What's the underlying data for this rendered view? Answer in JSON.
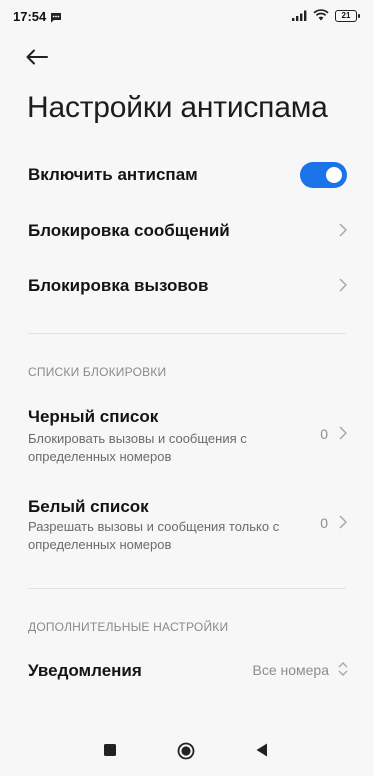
{
  "status_bar": {
    "time": "17:54",
    "battery": "21",
    "icons": [
      "message-icon",
      "signal-icon",
      "wifi-icon",
      "battery-icon"
    ]
  },
  "header": {
    "back_icon": "arrow-left-icon",
    "title": "Настройки антиспама"
  },
  "settings": {
    "enable_antispam": {
      "label": "Включить антиспам",
      "enabled": true
    },
    "block_messages": {
      "label": "Блокировка сообщений"
    },
    "block_calls": {
      "label": "Блокировка вызовов"
    }
  },
  "block_lists": {
    "header": "СПИСКИ БЛОКИРОВКИ",
    "blacklist": {
      "title": "Черный список",
      "subtitle": "Блокировать вызовы и сообщения с определенных номеров",
      "count": "0"
    },
    "whitelist": {
      "title": "Белый список",
      "subtitle": "Разрешать вызовы и сообщения только с определенных номеров",
      "count": "0"
    }
  },
  "additional": {
    "header": "ДОПОЛНИТЕЛЬНЫЕ НАСТРОЙКИ",
    "notifications": {
      "label": "Уведомления",
      "value": "Все номера"
    }
  },
  "nav_bar": {
    "icons": [
      "recents-square-icon",
      "home-circle-icon",
      "back-triangle-icon"
    ]
  },
  "colors": {
    "accent": "#1a73e8",
    "background": "#f7f7f7"
  }
}
